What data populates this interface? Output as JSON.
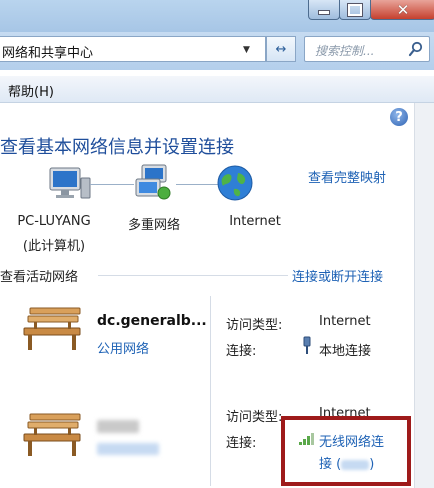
{
  "window": {
    "minimize_glyph": "",
    "close_glyph": "✕"
  },
  "address": {
    "path": "网络和共享中心",
    "dropdown_glyph": "▼",
    "refresh_glyph": "↔"
  },
  "search": {
    "placeholder": "搜索控制...",
    "icon": "search-icon"
  },
  "menu": {
    "help": "帮助(H)"
  },
  "help_button": "?",
  "page": {
    "title": "查看基本网络信息并设置连接",
    "view_full_map": "查看完整映射"
  },
  "map": {
    "computer_label": "PC-LUYANG",
    "computer_sub": "(此计算机)",
    "network_label": "多重网络",
    "internet_label": "Internet"
  },
  "active": {
    "section_title": "查看活动网络",
    "connect_link": "连接或断开连接",
    "networks": [
      {
        "name": "dc.generalb...",
        "type": "公用网络",
        "access_label": "访问类型:",
        "access_value": "Internet",
        "conn_label": "连接:",
        "conn_value": "本地连接"
      },
      {
        "access_label": "访问类型:",
        "access_value": "Internet",
        "conn_label": "连接:",
        "conn_value_line1": "无线网络连",
        "conn_value_line2": "接 ("
      }
    ]
  },
  "colors": {
    "link": "#1e62b5",
    "title": "#1f4e9b",
    "highlight": "#9e1a1a"
  }
}
